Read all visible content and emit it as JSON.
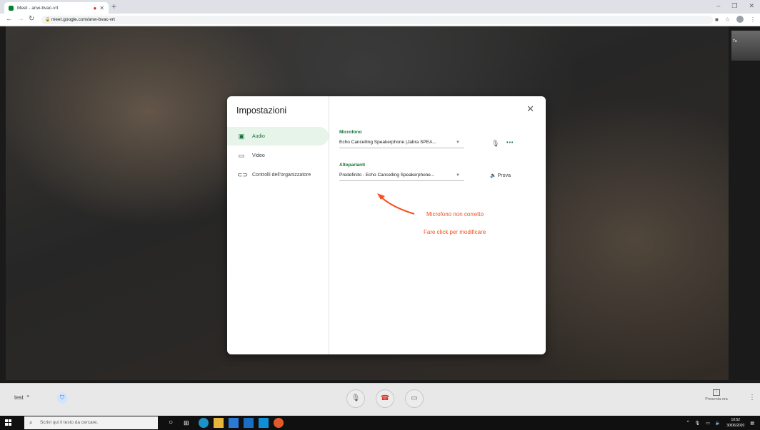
{
  "browser": {
    "tab_title": "Meet - anw-bvac-vrt",
    "tab_record_icon": "record-dot-icon",
    "url": "meet.google.com/anw-bvac-vrt"
  },
  "meet": {
    "self_view_label": "Tu",
    "meeting_name": "test",
    "present_label": "Presenta ora"
  },
  "settings_dialog": {
    "title": "Impostazioni",
    "nav": [
      {
        "label": "Audio",
        "icon": "speaker-device-icon",
        "active": true
      },
      {
        "label": "Video",
        "icon": "video-camera-icon",
        "active": false
      },
      {
        "label": "Controlli dell'organizzatore",
        "icon": "toggle-icon",
        "active": false
      }
    ],
    "microphone": {
      "label": "Microfono",
      "selected": "Echo Cancelling Speakerphone (Jabra SPEA..."
    },
    "speakers": {
      "label": "Altoparlanti",
      "selected": "Predefinito - Echo Cancelling Speakerphone...",
      "test_label": "Prova"
    },
    "more_label": "•••"
  },
  "annotation": {
    "line1": "Microfono non corretto",
    "line2": "Fare click per modificare",
    "color": "#f4511e"
  },
  "taskbar": {
    "search_placeholder": "Scrivi qui il testo da cercare.",
    "time": "10:52",
    "date": "30/06/2020"
  },
  "colors": {
    "accent_green": "#137333",
    "end_call_red": "#d93025"
  }
}
